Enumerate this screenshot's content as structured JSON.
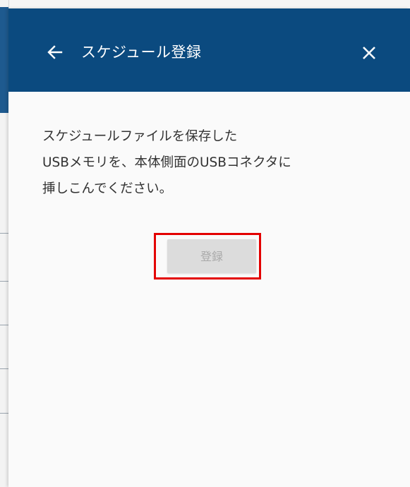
{
  "header": {
    "title": "スケジュール登録",
    "back_icon": "arrow-left-icon",
    "close_icon": "close-icon",
    "background_color": "#0b4a7f"
  },
  "message": {
    "lines": [
      "スケジュールファイルを保存した",
      "USBメモリを、本体側面のUSBコネクタに",
      "挿しこんでください。"
    ]
  },
  "actions": {
    "register_label": "登録",
    "register_disabled": true,
    "highlight_color": "#e30000"
  }
}
